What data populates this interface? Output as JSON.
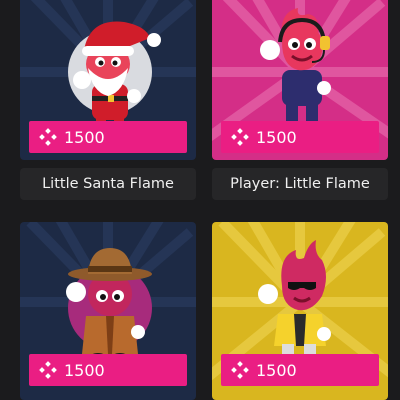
{
  "items": [
    {
      "name": "Little Santa Flame",
      "price": "1500",
      "theme": "dark-blue",
      "character": "santa-flame-icon"
    },
    {
      "name": "Player: Little Flame",
      "price": "1500",
      "theme": "pink",
      "character": "gamer-flame-icon"
    },
    {
      "price": "1500",
      "theme": "dark-blue",
      "character": "detective-flame-icon"
    },
    {
      "price": "1500",
      "theme": "yellow",
      "character": "cool-flame-icon"
    }
  ],
  "colors": {
    "accent": "#ea1e83",
    "background": "#1b1b1d",
    "label_box": "#262628"
  }
}
